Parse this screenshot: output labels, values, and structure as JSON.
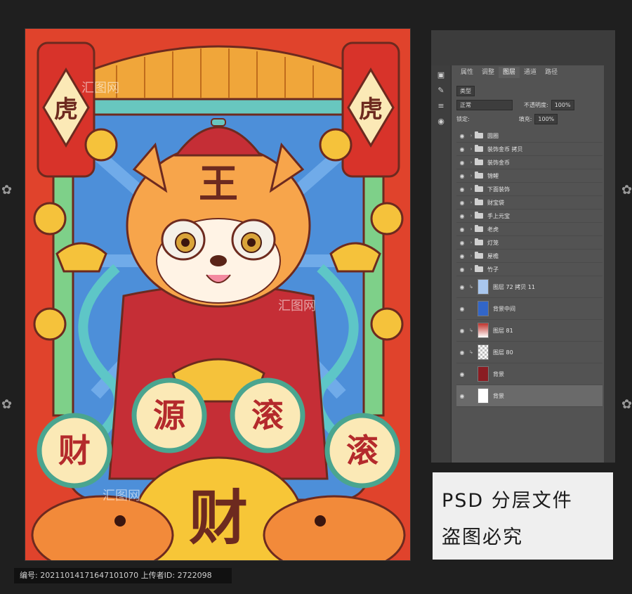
{
  "artwork": {
    "lantern_left": "虎",
    "lantern_right": "虎",
    "head_char": "王",
    "coin_chars": [
      "财",
      "源",
      "滚",
      "滚"
    ],
    "big_char": "财",
    "watermark_text": "汇图网"
  },
  "ps_panel": {
    "tabs": [
      "属性",
      "调整",
      "图层",
      "通道",
      "路径"
    ],
    "active_tab": "图层",
    "filter_label": "类型",
    "blend_mode": "正常",
    "opacity_label": "不透明度:",
    "opacity_value": "100%",
    "lock_label": "锁定:",
    "fill_label": "填充:",
    "fill_value": "100%",
    "groups": [
      "圆圈",
      "装饰金币 拷贝",
      "装饰金币",
      "锦鲤",
      "下面装饰",
      "财宝袋",
      "手上元宝",
      "老虎",
      "灯笼",
      "屋檐",
      "竹子"
    ],
    "layers": [
      {
        "name": "图层 72 拷贝 11",
        "thumb": "#a9c7ee"
      },
      {
        "name": "背景中间",
        "thumb": "#3266c8"
      },
      {
        "name": "图层 81",
        "thumb": "#c0332c"
      },
      {
        "name": "图层 80",
        "thumb": "#bdbdbd"
      },
      {
        "name": "背景",
        "thumb": "#8a1c22"
      },
      {
        "name": "背景",
        "thumb": "#ffffff"
      }
    ]
  },
  "caption": {
    "line1": "PSD 分层文件",
    "line2": "盗图必究"
  },
  "footer": {
    "text": "编号: 20211014171647101070 上传者ID: 2722098"
  }
}
